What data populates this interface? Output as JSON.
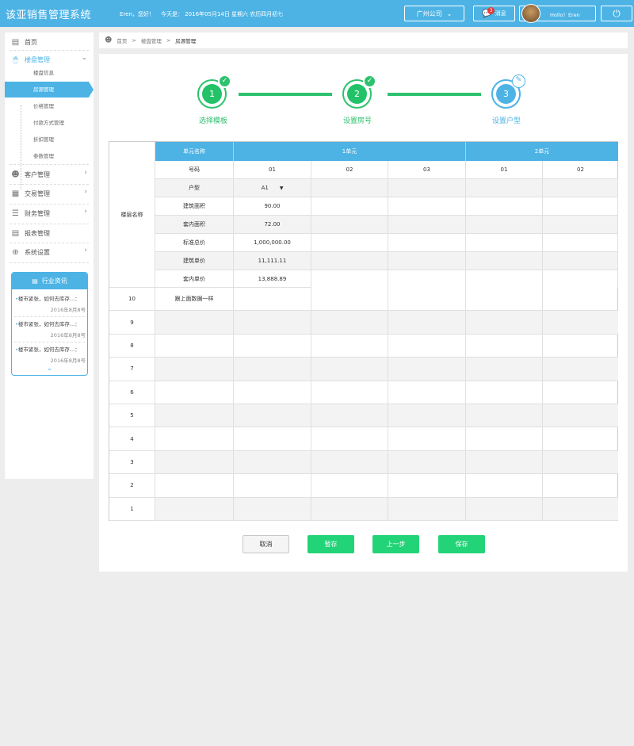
{
  "header": {
    "title": "该亚销售管理系统",
    "greeting": "Eren，您好！",
    "today": "今天是：  2016年05月14日   星期六   农历四月初七",
    "company": "广州公司",
    "messages_label": "消息",
    "messages_count": "3",
    "user_label": "Hollo！Eren"
  },
  "sidebar": {
    "home": "首页",
    "property": "楼盘管理",
    "sub": [
      "楼盘信息",
      "房源管理",
      "价格管理",
      "付款方式管理",
      "折扣管理",
      "参数管理"
    ],
    "items": [
      "客户管理",
      "交易管理",
      "财务管理",
      "报表管理",
      "系统设置"
    ],
    "news_title": "行业资讯",
    "news": [
      {
        "title": "楼市紧张，如何去库存…：",
        "date": "2016年8月8号"
      },
      {
        "title": "楼市紧张，如何去库存…：",
        "date": "2016年8月8号"
      },
      {
        "title": "楼市紧张，如何去库存…：",
        "date": "2016年8月8号"
      }
    ]
  },
  "breadcrumb": [
    "首页",
    ">",
    "楼盘管理",
    ">",
    "房源管理"
  ],
  "steps": [
    {
      "num": "1",
      "label": "选择模板"
    },
    {
      "num": "2",
      "label": "设置房号"
    },
    {
      "num": "3",
      "label": "设置户型"
    }
  ],
  "table": {
    "floor_header": "楼层名称",
    "unit_header": "单元名称",
    "units": [
      "1单元",
      "2单元"
    ],
    "row_labels": [
      "号码",
      "户型",
      "建筑面积",
      "套内面积",
      "标准总价",
      "建筑单价",
      "套内单价"
    ],
    "numbers": [
      "01",
      "02",
      "03",
      "01",
      "02"
    ],
    "col1_values": [
      "A1",
      "90.00",
      "72.00",
      "1,000,000.00",
      "11,111.11",
      "13,888.89"
    ],
    "floors": [
      "10",
      "9",
      "8",
      "7",
      "6",
      "5",
      "4",
      "3",
      "2",
      "1"
    ],
    "same_note": "跟上面数据一样"
  },
  "buttons": {
    "cancel": "取消",
    "draft": "暂存",
    "prev": "上一步",
    "save": "保存"
  }
}
